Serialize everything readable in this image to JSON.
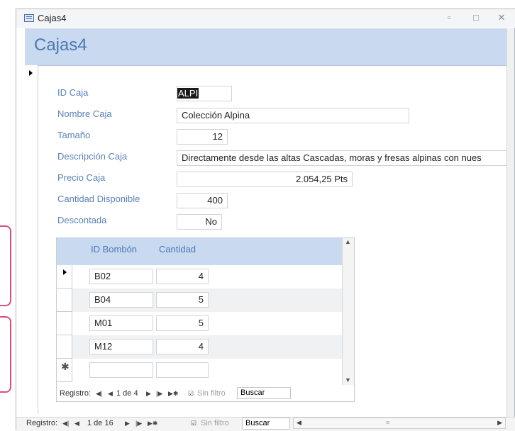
{
  "window": {
    "title": "Cajas4"
  },
  "form": {
    "header_title": "Cajas4",
    "fields": [
      {
        "label": "ID Caja",
        "value": "ALPI"
      },
      {
        "label": "Nombre Caja",
        "value": "Colección Alpina"
      },
      {
        "label": "Tamaño",
        "value": "12"
      },
      {
        "label": "Descripción Caja",
        "value": "Directamente desde las altas Cascadas, moras  y fresas alpinas con nues"
      },
      {
        "label": "Precio Caja",
        "value": "2.054,25 Pts"
      },
      {
        "label": "Cantidad Disponible",
        "value": "400"
      },
      {
        "label": "Descontada",
        "value": "No"
      }
    ]
  },
  "subform": {
    "columns": [
      "ID Bombón",
      "Cantidad"
    ],
    "rows": [
      {
        "id": "B02",
        "qty": "4"
      },
      {
        "id": "B04",
        "qty": "5"
      },
      {
        "id": "M01",
        "qty": "5"
      },
      {
        "id": "M12",
        "qty": "4"
      }
    ],
    "nav": {
      "label": "Registro:",
      "position": "1 de 4",
      "filter": "Sin filtro",
      "search": "Buscar"
    }
  },
  "main_nav": {
    "label": "Registro:",
    "position": "1 de 16",
    "filter": "Sin filtro",
    "search": "Buscar"
  },
  "icons": {
    "first": "first-record-icon",
    "prev": "previous-record-icon",
    "next": "next-record-icon",
    "last": "last-record-icon",
    "new": "new-record-icon",
    "filter": "filter-icon"
  }
}
